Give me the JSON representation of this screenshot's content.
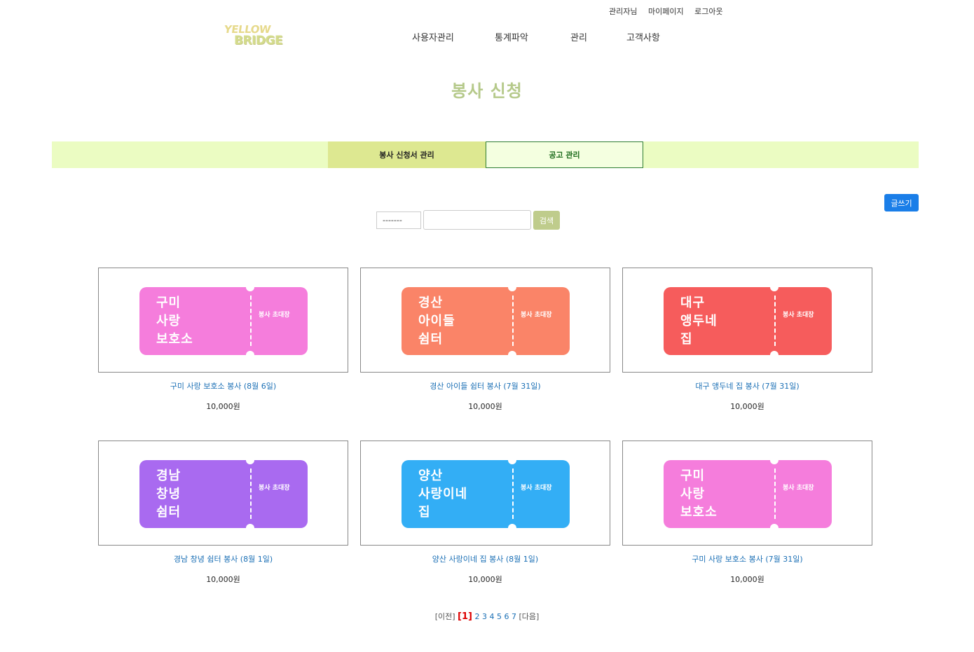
{
  "header": {
    "top_links": [
      "관리자님",
      "마이페이지",
      "로그아웃"
    ],
    "logo": {
      "line1": "YELLOW",
      "line2": "BRIDGE"
    },
    "nav": [
      "사용자관리",
      "통계파악",
      "관리",
      "고객사항"
    ]
  },
  "page_title": "봉사 신청",
  "tabs": [
    {
      "label": "봉사 신청서 관리",
      "active": true
    },
    {
      "label": "공고 관리",
      "active": false
    }
  ],
  "write_button": "글쓰기",
  "search": {
    "select_value": "-------",
    "input_value": "",
    "button": "검색"
  },
  "cards": [
    {
      "ticket_name": "구미\n사랑\n보호소",
      "ticket_label": "봉사 초대장",
      "color": "#f57ddc",
      "title": "구미 사랑 보호소 봉사 (8월 6일)",
      "price": "10,000원"
    },
    {
      "ticket_name": "경산\n아이들\n쉼터",
      "ticket_label": "봉사 초대장",
      "color": "#fa8468",
      "title": "경산 아이들 쉼터 봉사 (7월 31일)",
      "price": "10,000원"
    },
    {
      "ticket_name": "대구\n앵두네\n집",
      "ticket_label": "봉사 초대장",
      "color": "#f65c5c",
      "title": "대구 앵두네 집 봉사 (7월 31일)",
      "price": "10,000원"
    },
    {
      "ticket_name": "경남\n창녕\n쉼터",
      "ticket_label": "봉사 초대장",
      "color": "#a96af0",
      "title": "경남 창녕 쉼터 봉사 (8월 1일)",
      "price": "10,000원"
    },
    {
      "ticket_name": "양산\n사랑이네\n집",
      "ticket_label": "봉사 초대장",
      "color": "#33aef5",
      "title": "양산 사랑이네 집 봉사 (8월 1일)",
      "price": "10,000원"
    },
    {
      "ticket_name": "구미\n사랑\n보호소",
      "ticket_label": "봉사 초대장",
      "color": "#f57ddc",
      "title": "구미 사랑 보호소 봉사 (7월 31일)",
      "price": "10,000원"
    }
  ],
  "pagination": {
    "prev": "[이전]",
    "current": "[1]",
    "pages": [
      "2",
      "3",
      "4",
      "5",
      "6",
      "7"
    ],
    "next": "[다음]"
  }
}
